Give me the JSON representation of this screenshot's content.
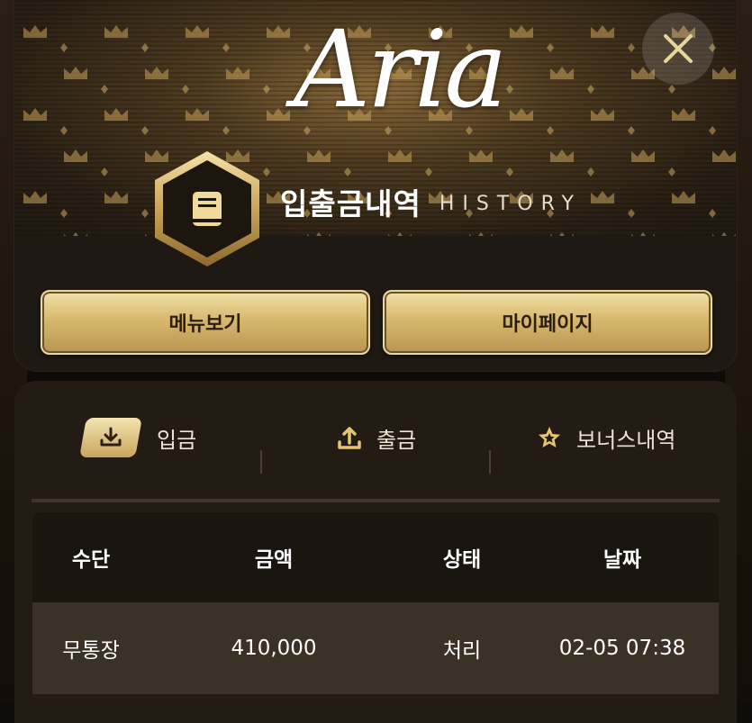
{
  "header": {
    "logo_text": "Aria",
    "title_ko": "입출금내역",
    "title_en": "HISTORY",
    "buttons": {
      "menu_label": "메뉴보기",
      "mypage_label": "마이페이지"
    }
  },
  "tabs": [
    {
      "label": "입금",
      "icon": "download-icon",
      "active": true
    },
    {
      "label": "출금",
      "icon": "upload-icon",
      "active": false
    },
    {
      "label": "보너스내역",
      "icon": "star-icon",
      "active": false
    }
  ],
  "table": {
    "headers": [
      "수단",
      "금액",
      "상태",
      "날짜"
    ],
    "rows": [
      [
        "무통장",
        "410,000",
        "처리",
        "02-05 07:38"
      ]
    ]
  },
  "colors": {
    "gold": "#d8b86e",
    "dark_bg": "#1e1912",
    "row_bg": "#3a3127"
  }
}
